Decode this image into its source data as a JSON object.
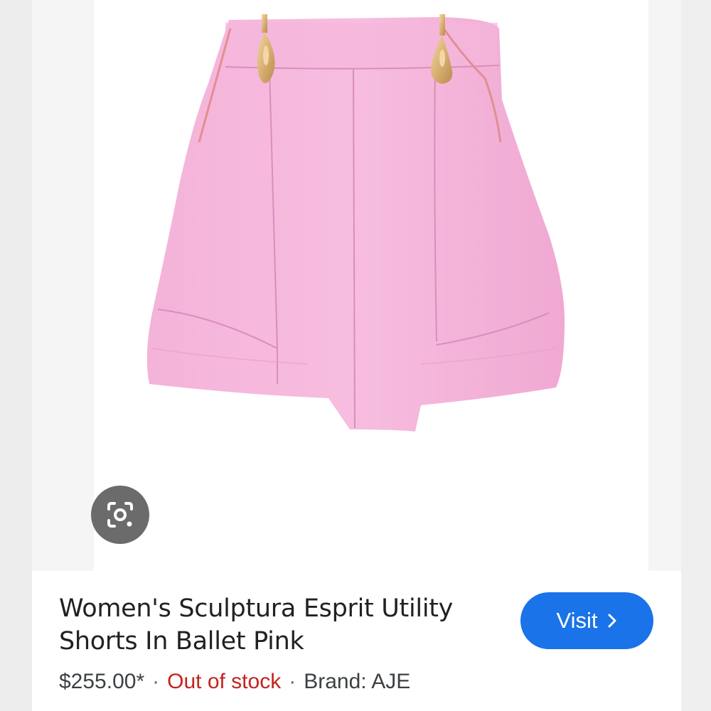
{
  "product": {
    "title": "Women's Sculptura Esprit Utility Shorts In Ballet Pink",
    "price": "$255.00*",
    "separator": "·",
    "stock_status": "Out of stock",
    "brand": "Brand: AJE"
  },
  "actions": {
    "visit_label": "Visit"
  },
  "icons": {
    "lens": "google-lens-icon",
    "visit_chevron": "chevron-right-icon"
  },
  "colors": {
    "visit_button": "#1a73e8",
    "stock_status": "#c5221f",
    "shorts_pink": "#f2aed6",
    "zipper_gold": "#d8b070"
  }
}
